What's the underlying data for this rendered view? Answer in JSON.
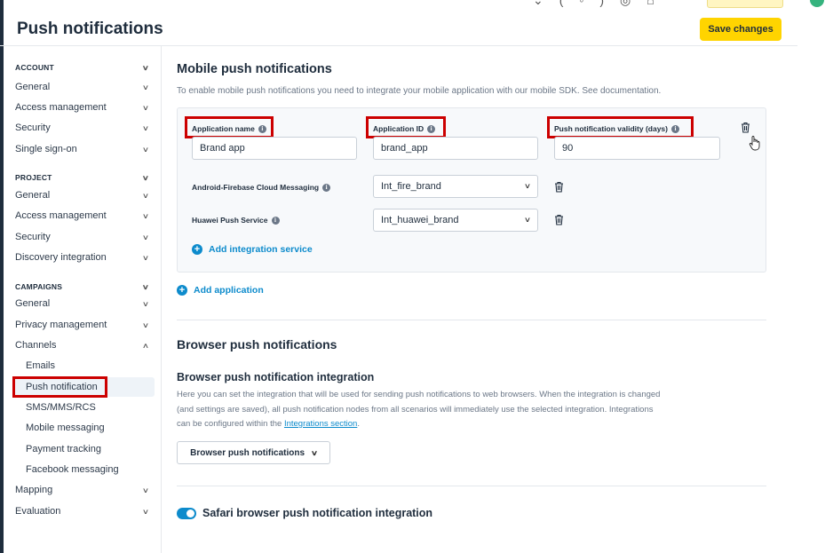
{
  "header": {
    "title": "Push notifications",
    "save_label": "Save changes"
  },
  "sidebar": {
    "sections": [
      {
        "label": "ACCOUNT",
        "items": [
          "General",
          "Access management",
          "Security",
          "Single sign-on"
        ]
      },
      {
        "label": "PROJECT",
        "items": [
          "General",
          "Access management",
          "Security",
          "Discovery integration"
        ]
      },
      {
        "label": "CAMPAIGNS",
        "items": [
          "General",
          "Privacy management",
          "Channels"
        ]
      }
    ],
    "channels_sub": [
      "Emails",
      "Push notification",
      "SMS/MMS/RCS",
      "Mobile messaging",
      "Payment tracking",
      "Facebook messaging"
    ],
    "bottom_items": [
      "Mapping",
      "Evaluation"
    ],
    "active_item": "Push notification"
  },
  "mobile": {
    "title": "Mobile push notifications",
    "description": "To enable mobile push notifications you need to integrate your mobile application with our mobile SDK. See documentation.",
    "app_name_label": "Application name",
    "app_name_value": "Brand app",
    "app_id_label": "Application  ID",
    "app_id_value": "brand_app",
    "validity_label": "Push notification validity (days)",
    "validity_value": "90",
    "firebase_label": "Android-Firebase Cloud Messaging",
    "firebase_value": "Int_fire_brand",
    "huawei_label": "Huawei Push Service",
    "huawei_value": "Int_huawei_brand",
    "add_integration_label": "Add integration service",
    "add_application_label": "Add application"
  },
  "browser": {
    "title": "Browser push notifications",
    "subtitle": "Browser push notification integration",
    "para_line1": "Here you can set the integration that will be used for sending push notifications to web browsers. When the integration is changed",
    "para_line2": "(and settings are saved), all push notification nodes from all scenarios will immediately use the selected integration. Integrations",
    "para_line3_pre": "can be configured within the ",
    "para_link": "Integrations section",
    "para_line3_post": ".",
    "dropdown_label": "Browser push notifications",
    "safari_label": "Safari browser push notification integration",
    "safari_enabled": true
  },
  "colors": {
    "accent": "#0d8bcc",
    "save": "#ffd400",
    "highlight": "#cc0000"
  }
}
